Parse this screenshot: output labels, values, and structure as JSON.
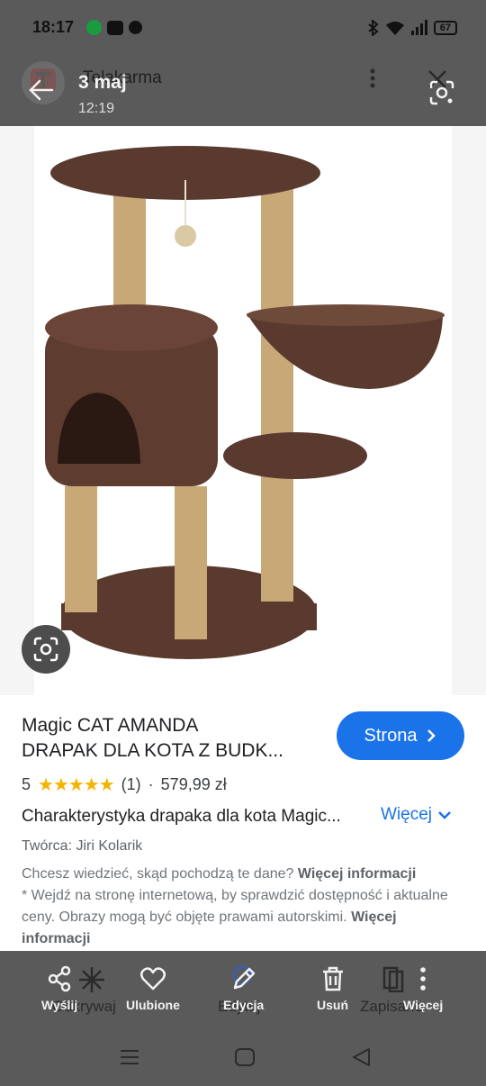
{
  "status_bar": {
    "time": "18:17",
    "battery": "67"
  },
  "header": {
    "app_name": "Telakarma",
    "date": "3 maj",
    "time": "12:19"
  },
  "product": {
    "title_line1": "Magic CAT AMANDA",
    "title_line2": "DRAPAK DLA KOTA Z BUDK...",
    "visit_label": "Strona",
    "rating": "5",
    "stars": "★★★★★",
    "review_count": "(1)",
    "separator": "·",
    "price": "579,99 zł",
    "description": "Charakterystyka drapaka dla kota Magic...",
    "more_label": "Więcej",
    "creator": "Twórca: Jiri Kolarik",
    "disclaimer_text1": "Chcesz wiedzieć, skąd pochodzą te dane? ",
    "disclaimer_link1": "Więcej informacji",
    "disclaimer_text2": "* Wejdź na stronę internetową, by sprawdzić dostępność i aktualne ceny. Obrazy mogą być objęte prawami autorskimi. ",
    "disclaimer_link2": "Więcej informacji"
  },
  "actions": {
    "share": "Wyślij",
    "favorite": "Ulubione",
    "edit": "Edycja",
    "delete": "Usuń",
    "more": "Więcej"
  },
  "background_actions": {
    "discover": "Odkrywaj",
    "edit": "Edytuj",
    "save": "Zapisane"
  },
  "colors": {
    "accent": "#1a73e8",
    "star": "#f5b301",
    "cat_tree": "#5a3a2e",
    "sisal": "#c9a878"
  }
}
